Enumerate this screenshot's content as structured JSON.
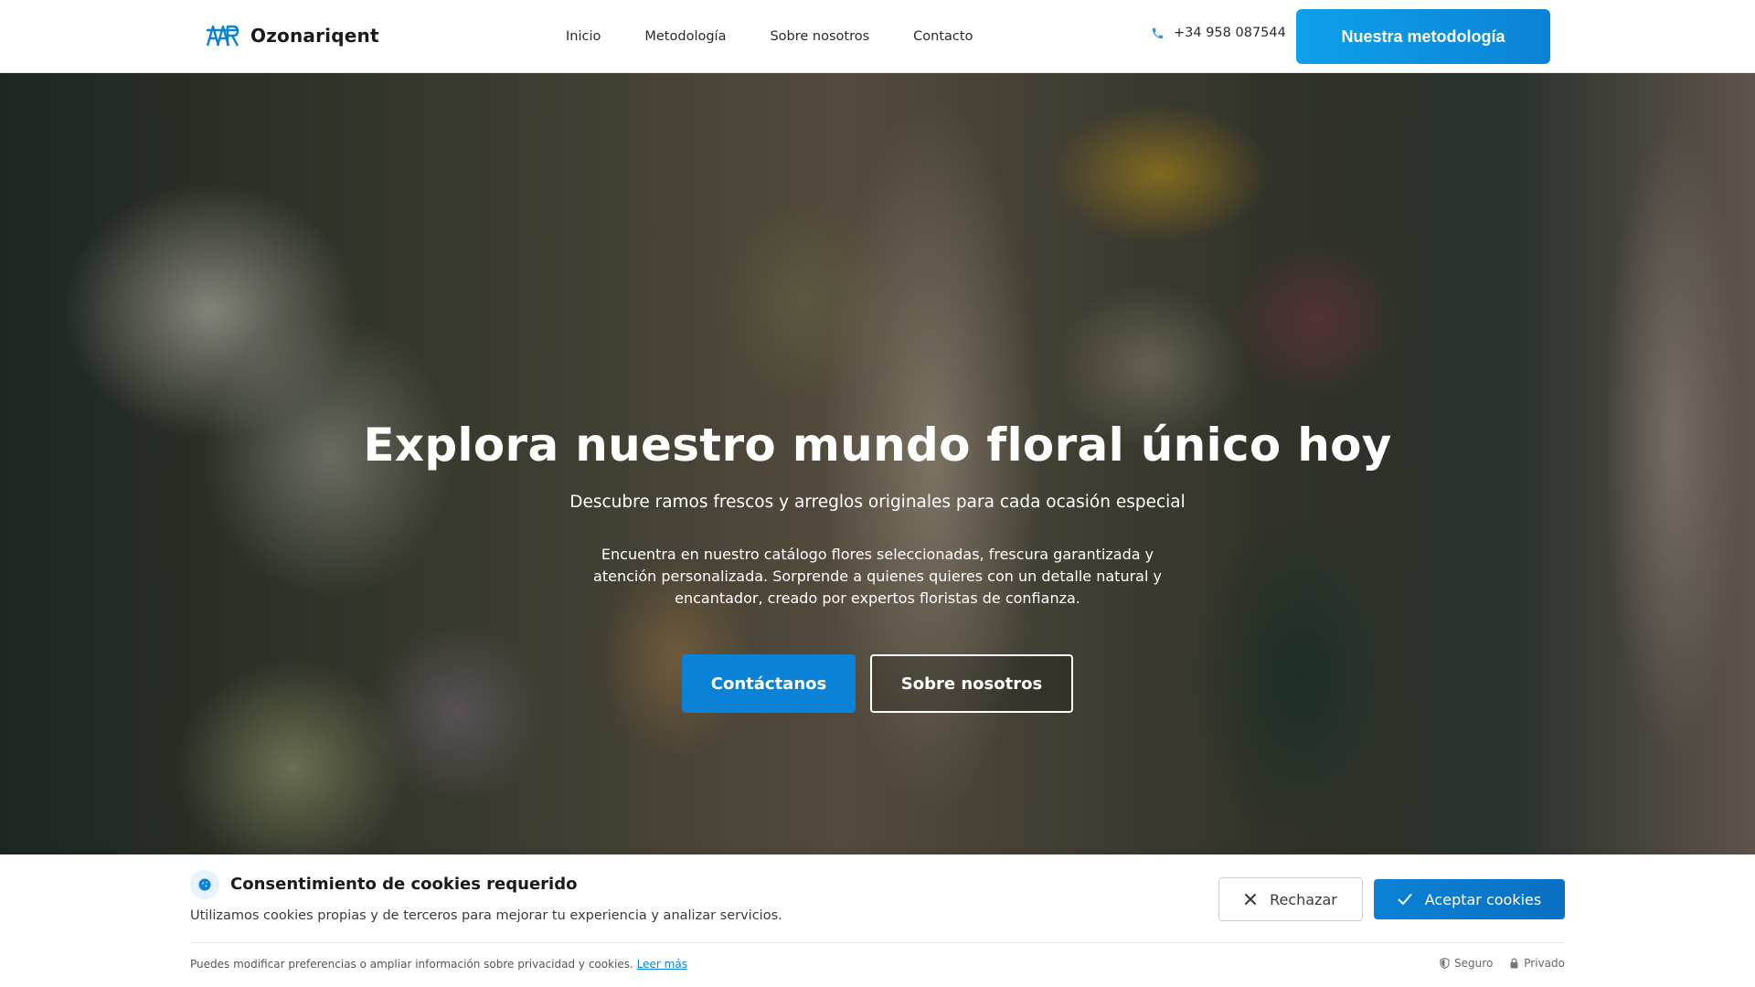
{
  "brand": {
    "name": "Ozonariqent",
    "accent": "#0b82d6"
  },
  "nav": {
    "items": [
      "Inicio",
      "Metodología",
      "Sobre nosotros",
      "Contacto"
    ]
  },
  "header": {
    "phone": "+34 958 087544",
    "cta_label": "Nuestra metodología"
  },
  "hero": {
    "title": "Explora nuestro mundo floral único hoy",
    "subtitle": "Descubre ramos frescos y arreglos originales para cada ocasión especial",
    "body": "Encuentra en nuestro catálogo flores seleccionadas, frescura garantizada y atención personalizada. Sorprende a quienes quieres con un detalle natural y encantador, creado por expertos floristas de confianza.",
    "primary_button": "Contáctanos",
    "secondary_button": "Sobre nosotros"
  },
  "cookie": {
    "title": "Consentimiento de cookies requerido",
    "text": "Utilizamos cookies propias y de terceros para mejorar tu experiencia y analizar servicios.",
    "reject_label": "Rechazar",
    "accept_label": "Aceptar cookies",
    "footer_text": "Puedes modificar preferencias o ampliar información sobre privacidad y cookies.",
    "read_more": "Leer más",
    "badge_secure": "Seguro",
    "badge_private": "Privado"
  },
  "icons": {
    "logo": "brand-logo-icon",
    "phone": "phone-icon",
    "cookie": "cookie-icon",
    "reject": "close-icon",
    "accept": "check-icon",
    "secure": "shield-icon",
    "private": "lock-icon"
  }
}
